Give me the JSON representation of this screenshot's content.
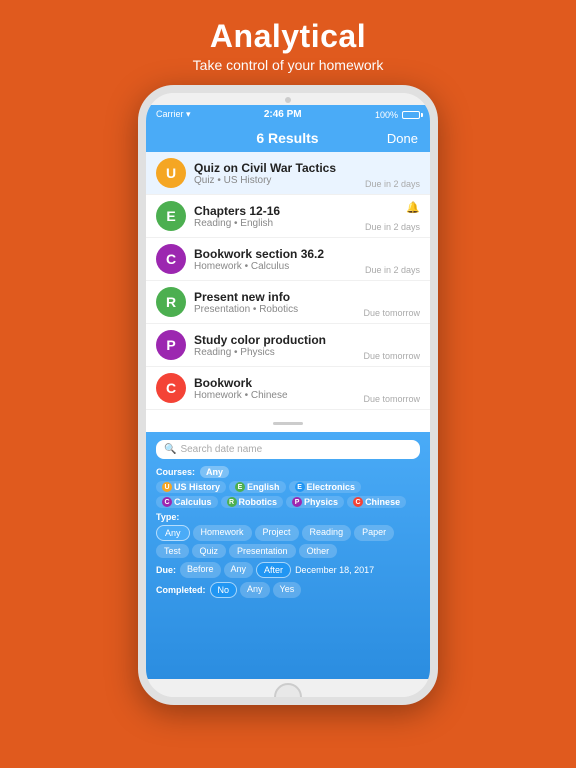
{
  "page": {
    "bg_color": "#E05A1E",
    "heading": "Analytical",
    "subheading": "Take control of your homework"
  },
  "status_bar": {
    "carrier": "Carrier ▾",
    "time": "2:46 PM",
    "battery": "100%"
  },
  "nav": {
    "title": "6 Results",
    "done_label": "Done"
  },
  "items": [
    {
      "avatar_letter": "U",
      "avatar_color": "#F5A623",
      "title": "Quiz on Civil War Tactics",
      "subtitle": "Quiz • US History",
      "due": "Due in 2 days",
      "bell": false,
      "selected": true
    },
    {
      "avatar_letter": "E",
      "avatar_color": "#4CAF50",
      "title": "Chapters 12-16",
      "subtitle": "Reading • English",
      "due": "Due in 2 days",
      "bell": true,
      "selected": false
    },
    {
      "avatar_letter": "C",
      "avatar_color": "#9C27B0",
      "title": "Bookwork section 36.2",
      "subtitle": "Homework • Calculus",
      "due": "Due in 2 days",
      "bell": false,
      "selected": false
    },
    {
      "avatar_letter": "R",
      "avatar_color": "#4CAF50",
      "title": "Present new info",
      "subtitle": "Presentation • Robotics",
      "due": "Due tomorrow",
      "bell": false,
      "selected": false
    },
    {
      "avatar_letter": "P",
      "avatar_color": "#9C27B0",
      "title": "Study color production",
      "subtitle": "Reading • Physics",
      "due": "Due tomorrow",
      "bell": false,
      "selected": false
    },
    {
      "avatar_letter": "C",
      "avatar_color": "#F44336",
      "title": "Bookwork",
      "subtitle": "Homework • Chinese",
      "due": "Due tomorrow",
      "bell": false,
      "selected": false
    }
  ],
  "search": {
    "placeholder": "Search date name"
  },
  "courses_label": "Courses:",
  "courses_any": "Any",
  "courses": [
    {
      "letter": "U",
      "color": "#F5A623",
      "bg": "#fff3e0",
      "name": "US History"
    },
    {
      "letter": "E",
      "color": "#4CAF50",
      "bg": "#e8f5e9",
      "name": "English"
    },
    {
      "letter": "E",
      "color": "#2196F3",
      "bg": "#e3f2fd",
      "name": "Electronics"
    },
    {
      "letter": "C",
      "color": "#9C27B0",
      "bg": "#f3e5f5",
      "name": "Calculus"
    },
    {
      "letter": "R",
      "color": "#4CAF50",
      "bg": "#e8f5e9",
      "name": "Robotics"
    },
    {
      "letter": "P",
      "color": "#9C27B0",
      "bg": "#f3e5f5",
      "name": "Physics"
    },
    {
      "letter": "C",
      "color": "#F44336",
      "bg": "#ffebee",
      "name": "Chinese"
    }
  ],
  "type_label": "Type:",
  "type_any": "Any",
  "type_options": [
    "Homework",
    "Project",
    "Reading",
    "Paper",
    "Test",
    "Quiz",
    "Presentation",
    "Other"
  ],
  "type_active": "Any",
  "due_label": "Due:",
  "due_options": [
    "Before",
    "Any",
    "After"
  ],
  "due_active": "After",
  "due_date": "December 18, 2017",
  "completed_label": "Completed:",
  "completed_options": [
    "No",
    "Any",
    "Yes"
  ],
  "completed_active": "No"
}
